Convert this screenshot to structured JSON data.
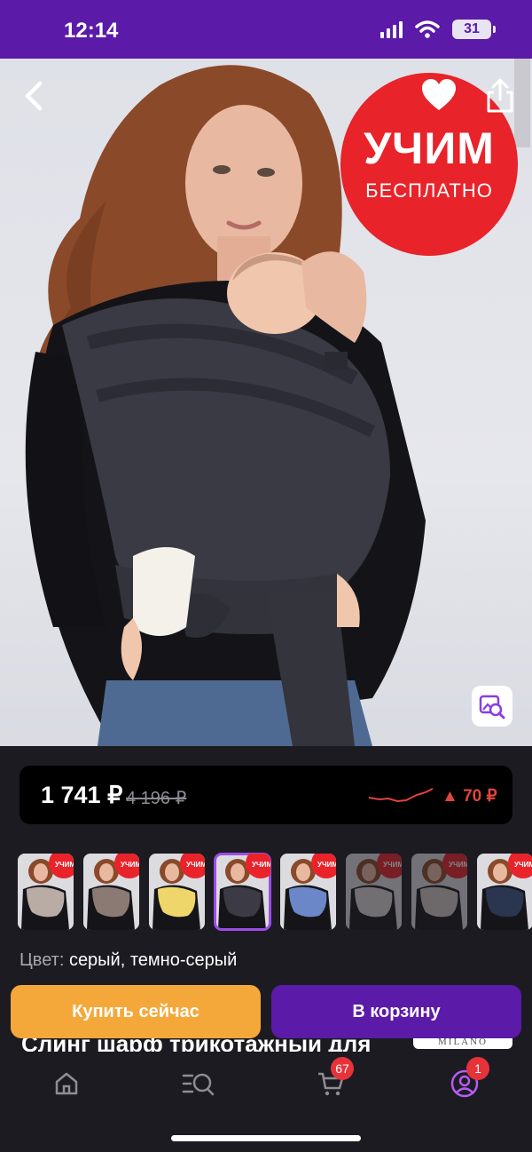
{
  "status_bar": {
    "time": "12:14",
    "battery": "31"
  },
  "hero": {
    "promo_title": "УЧИМ",
    "promo_subtitle": "БЕСПЛАТНО"
  },
  "price": {
    "current": "1 741 ₽",
    "old": "4 196 ₽",
    "change": "▲ 70 ₽",
    "change_color": "#e0453b"
  },
  "variants": [
    {
      "badge": "УЧИМ",
      "color": "#b9aca5",
      "state": "normal"
    },
    {
      "badge": "УЧИМ",
      "color": "#8b7a73",
      "state": "normal"
    },
    {
      "badge": "УЧИМ",
      "color": "#eed66a",
      "state": "normal"
    },
    {
      "badge": "УЧИМ",
      "color": "#3c3b45",
      "state": "selected"
    },
    {
      "badge": "УЧИМ",
      "color": "#6b87c8",
      "state": "normal"
    },
    {
      "badge": "УЧИМ",
      "color": "#d9d6d3",
      "state": "faded"
    },
    {
      "badge": "УЧИМ",
      "color": "#cfc9c3",
      "state": "faded"
    },
    {
      "badge": "УЧИМ",
      "color": "#2a3550",
      "state": "normal"
    }
  ],
  "color": {
    "label": "Цвет:",
    "value": "серый, темно-серый"
  },
  "actions": {
    "buy_now": "Купить сейчас",
    "add_to_cart": "В корзину"
  },
  "product": {
    "title": "Слинг шарф трикотажный для",
    "brand": "MILANO"
  },
  "tabbar": {
    "cart_badge": "67",
    "profile_badge": "1",
    "active_color": "#b65cf2"
  }
}
